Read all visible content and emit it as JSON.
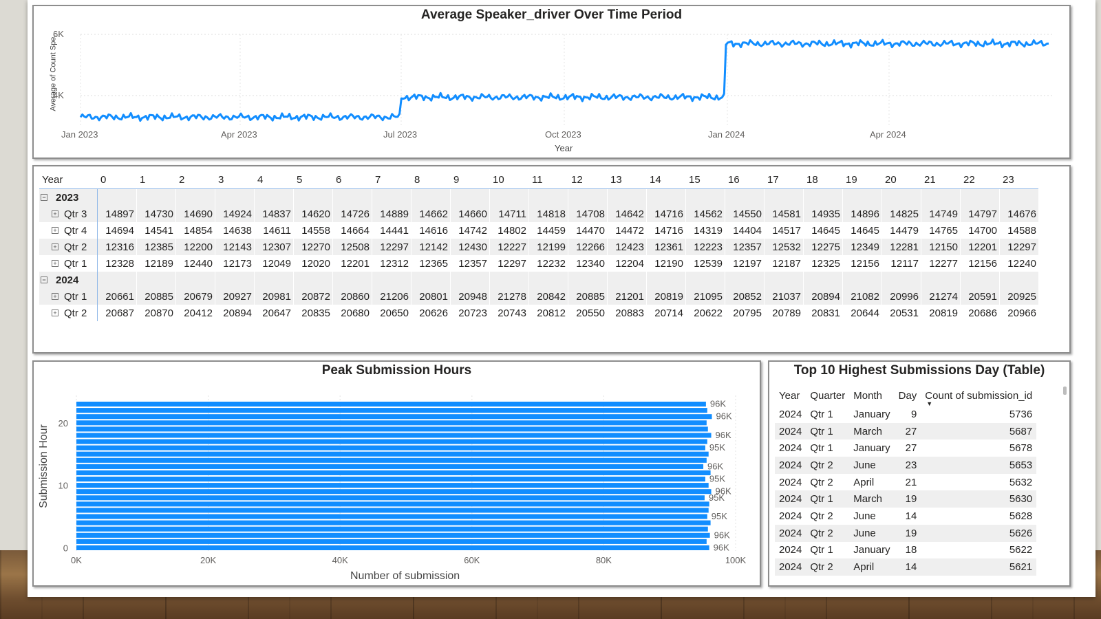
{
  "line_chart": {
    "title": "Average Speaker_driver Over Time Period",
    "ylabel": "Average of Count Spe...",
    "xlabel": "Year",
    "y_ticks": [
      "6K",
      "4K"
    ],
    "x_ticks": [
      "Jan 2023",
      "Apr 2023",
      "Jul 2023",
      "Oct 2023",
      "Jan 2024",
      "Apr 2024"
    ],
    "color": "#118dff"
  },
  "matrix": {
    "corner": "Year",
    "hours": [
      "0",
      "1",
      "2",
      "3",
      "4",
      "5",
      "6",
      "7",
      "8",
      "9",
      "10",
      "11",
      "12",
      "13",
      "14",
      "15",
      "16",
      "17",
      "18",
      "19",
      "20",
      "21",
      "22",
      "23"
    ],
    "groups": [
      {
        "year": "2023",
        "rows": [
          {
            "label": "Qtr 3",
            "values": [
              "14897",
              "14730",
              "14690",
              "14924",
              "14837",
              "14620",
              "14726",
              "14889",
              "14662",
              "14660",
              "14711",
              "14818",
              "14708",
              "14642",
              "14716",
              "14562",
              "14550",
              "14581",
              "14935",
              "14896",
              "14825",
              "14749",
              "14797",
              "14676"
            ]
          },
          {
            "label": "Qtr 4",
            "values": [
              "14694",
              "14541",
              "14854",
              "14638",
              "14611",
              "14558",
              "14664",
              "14441",
              "14616",
              "14742",
              "14802",
              "14459",
              "14470",
              "14472",
              "14716",
              "14319",
              "14404",
              "14517",
              "14645",
              "14645",
              "14479",
              "14765",
              "14700",
              "14588"
            ]
          },
          {
            "label": "Qtr 2",
            "values": [
              "12316",
              "12385",
              "12200",
              "12143",
              "12307",
              "12270",
              "12508",
              "12297",
              "12142",
              "12430",
              "12227",
              "12199",
              "12266",
              "12423",
              "12361",
              "12223",
              "12357",
              "12532",
              "12275",
              "12349",
              "12281",
              "12150",
              "12201",
              "12297"
            ]
          },
          {
            "label": "Qtr 1",
            "values": [
              "12328",
              "12189",
              "12440",
              "12173",
              "12049",
              "12020",
              "12201",
              "12312",
              "12365",
              "12357",
              "12297",
              "12232",
              "12340",
              "12204",
              "12190",
              "12539",
              "12197",
              "12187",
              "12325",
              "12156",
              "12117",
              "12277",
              "12156",
              "12240"
            ]
          }
        ]
      },
      {
        "year": "2024",
        "rows": [
          {
            "label": "Qtr 1",
            "values": [
              "20661",
              "20885",
              "20679",
              "20927",
              "20981",
              "20872",
              "20860",
              "21206",
              "20801",
              "20948",
              "21278",
              "20842",
              "20885",
              "21201",
              "20819",
              "21095",
              "20852",
              "21037",
              "20894",
              "21082",
              "20996",
              "21274",
              "20591",
              "20925"
            ]
          },
          {
            "label": "Qtr 2",
            "values": [
              "20687",
              "20870",
              "20412",
              "20894",
              "20647",
              "20835",
              "20680",
              "20650",
              "20626",
              "20723",
              "20743",
              "20812",
              "20550",
              "20883",
              "20714",
              "20622",
              "20795",
              "20789",
              "20831",
              "20644",
              "20531",
              "20819",
              "20686",
              "20966"
            ]
          }
        ]
      }
    ]
  },
  "chart_data": {
    "type": "bar",
    "orientation": "horizontal",
    "title": "Peak Submission Hours",
    "xlabel": "Number of submission",
    "ylabel": "Submission Hour",
    "categories": [
      0,
      1,
      2,
      3,
      4,
      5,
      6,
      7,
      8,
      9,
      10,
      11,
      12,
      13,
      14,
      15,
      16,
      17,
      18,
      19,
      20,
      21,
      22,
      23
    ],
    "values": [
      96000,
      95600,
      96100,
      95800,
      96200,
      95700,
      95900,
      96000,
      95300,
      96300,
      95900,
      95400,
      96200,
      95100,
      95600,
      95900,
      95400,
      95700,
      96300,
      95800,
      95600,
      96400,
      95700,
      95500
    ],
    "value_labels": [
      "96K",
      "",
      "96K",
      "",
      "",
      "95K",
      "",
      "",
      "95K",
      "96K",
      "",
      "95K",
      "",
      "96K",
      "",
      "",
      "95K",
      "",
      "96K",
      "",
      "",
      "96K",
      "",
      "96K"
    ],
    "xlim": [
      0,
      100000
    ],
    "x_ticks": [
      "0K",
      "20K",
      "40K",
      "60K",
      "80K",
      "100K"
    ],
    "y_ticks": [
      "0",
      "10",
      "20"
    ],
    "color": "#118dff"
  },
  "top10": {
    "title": "Top 10 Highest Submissions Day (Table)",
    "columns": [
      "Year",
      "Quarter",
      "Month",
      "Day",
      "Count of submission_id"
    ],
    "sort_icon": "sort-desc-icon",
    "rows": [
      [
        "2024",
        "Qtr 1",
        "January",
        "9",
        "5736"
      ],
      [
        "2024",
        "Qtr 1",
        "March",
        "27",
        "5687"
      ],
      [
        "2024",
        "Qtr 1",
        "January",
        "27",
        "5678"
      ],
      [
        "2024",
        "Qtr 2",
        "June",
        "23",
        "5653"
      ],
      [
        "2024",
        "Qtr 2",
        "April",
        "21",
        "5632"
      ],
      [
        "2024",
        "Qtr 1",
        "March",
        "19",
        "5630"
      ],
      [
        "2024",
        "Qtr 2",
        "June",
        "14",
        "5628"
      ],
      [
        "2024",
        "Qtr 2",
        "June",
        "19",
        "5626"
      ],
      [
        "2024",
        "Qtr 1",
        "January",
        "18",
        "5622"
      ],
      [
        "2024",
        "Qtr 2",
        "April",
        "14",
        "5621"
      ]
    ]
  }
}
